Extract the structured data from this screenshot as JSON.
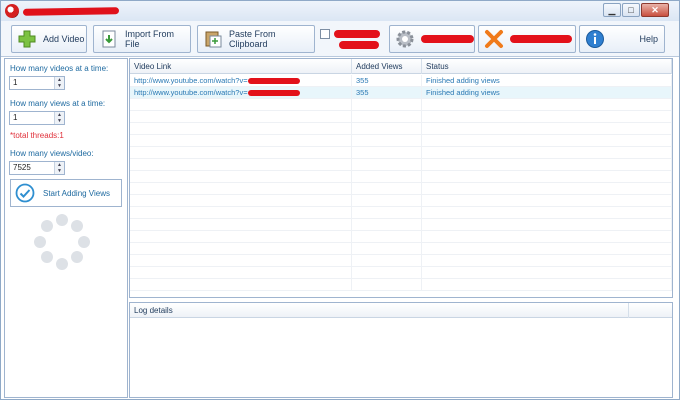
{
  "window": {
    "title": ""
  },
  "toolbar": {
    "add_video": "Add Video",
    "import_file": "Import From File",
    "paste_clipboard": "Paste From Clipboard",
    "help": "Help"
  },
  "settings": {
    "videos_at_time_label": "How many videos at a time:",
    "videos_at_time_value": "1",
    "views_at_time_label": "How many views at a time:",
    "views_at_time_value": "1",
    "total_threads": "*total threads:1",
    "views_per_video_label": "How many views/video:",
    "views_per_video_value": "7525",
    "start_button": "Start Adding Views"
  },
  "grid": {
    "columns": [
      "Video Link",
      "Added Views",
      "Status"
    ],
    "rows": [
      {
        "link": "http://www.youtube.com/watch?v=",
        "views": "355",
        "status": "Finished adding views"
      },
      {
        "link": "http://www.youtube.com/watch?v=",
        "views": "355",
        "status": "Finished adding views"
      }
    ]
  },
  "log": {
    "header": "Log details"
  },
  "colors": {
    "accent": "#1e6aa0",
    "redaction": "#e3111a",
    "selected_row": "#e8f6fb"
  }
}
